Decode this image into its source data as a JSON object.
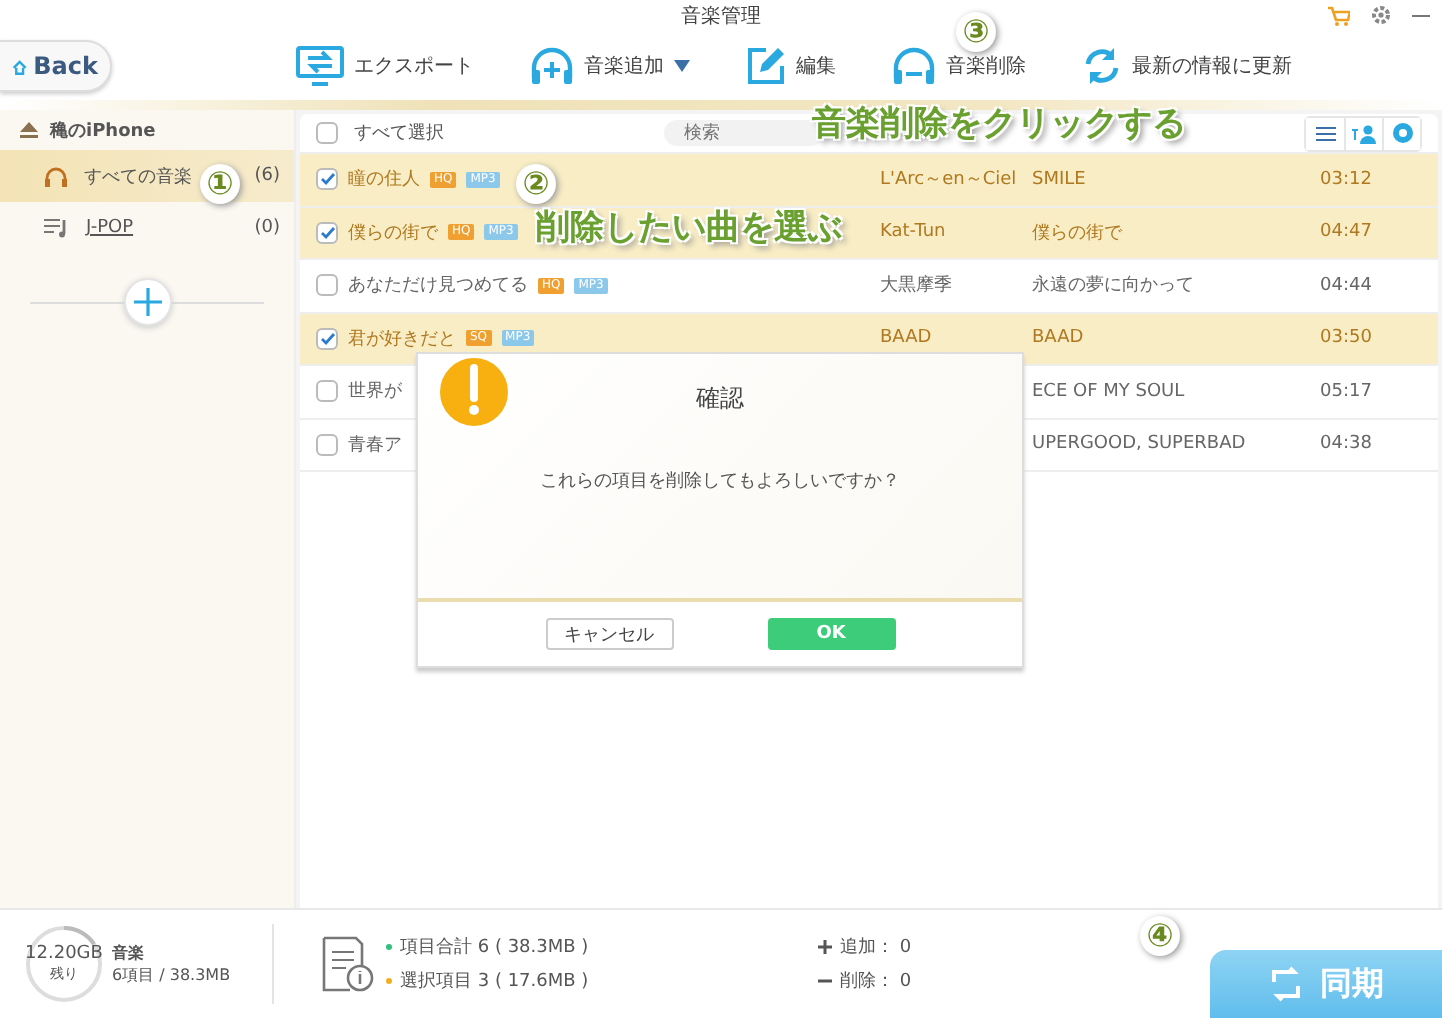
{
  "window": {
    "title": "音楽管理"
  },
  "back_button": "Back",
  "toolbar": [
    {
      "label": "エクスポート",
      "kind": "export",
      "dropdown": false
    },
    {
      "label": "音楽追加",
      "kind": "add",
      "dropdown": true
    },
    {
      "label": "編集",
      "kind": "edit",
      "dropdown": false
    },
    {
      "label": "音楽削除",
      "kind": "delete",
      "dropdown": false
    },
    {
      "label": "最新の情報に更新",
      "kind": "refresh",
      "dropdown": false
    }
  ],
  "sidebar": {
    "device": "穐のiPhone",
    "items": [
      {
        "label": "すべての音楽",
        "count": "(6)",
        "selected": true,
        "kind": "all"
      },
      {
        "label": "J-POP",
        "count": "(0)",
        "selected": false,
        "kind": "playlist"
      }
    ]
  },
  "list": {
    "select_all": {
      "label": "すべて選択",
      "checked": false
    },
    "search": {
      "placeholder": "検索"
    },
    "rows": [
      {
        "title": "瞳の住人",
        "badges": [
          "HQ",
          "MP3"
        ],
        "artist": "L'Arc～en～Ciel",
        "album": "SMILE",
        "time": "03:12",
        "checked": true
      },
      {
        "title": "僕らの街で",
        "badges": [
          "HQ",
          "MP3"
        ],
        "artist": "Kat-Tun",
        "album": "僕らの街で",
        "time": "04:47",
        "checked": true
      },
      {
        "title": "あなただけ見つめてる",
        "badges": [
          "HQ",
          "MP3"
        ],
        "artist": "大黒摩季",
        "album": "永遠の夢に向かって",
        "time": "04:44",
        "checked": false
      },
      {
        "title": "君が好きだと",
        "badges": [
          "SQ",
          "MP3"
        ],
        "artist": "BAAD",
        "album": "BAAD",
        "time": "03:50",
        "checked": true
      },
      {
        "title": "世界が",
        "badges": [],
        "artist": "",
        "album": "ECE OF MY SOUL",
        "time": "05:17",
        "checked": false
      },
      {
        "title": "青春ア",
        "badges": [],
        "artist": "",
        "album": "UPERGOOD, SUPERBAD",
        "time": "04:38",
        "checked": false
      }
    ]
  },
  "dialog": {
    "title": "確認",
    "message": "これらの項目を削除してもよろしいですか？",
    "buttons": [
      {
        "label": "キャンセル",
        "kind": "secondary"
      },
      {
        "label": "OK",
        "kind": "primary"
      }
    ]
  },
  "status": {
    "free": "12.20GB",
    "free_label": "残り",
    "category": "音楽",
    "summary": "6項目 / 38.3MB",
    "total": "項目合計 6 ( 38.3MB )",
    "selected": "選択項目 3 ( 17.6MB )",
    "added": "追加： 0",
    "deleted": "削除： 0",
    "sync_button": "同期"
  },
  "annotations": [
    {
      "label": "①"
    },
    {
      "label": "②"
    },
    {
      "label": "③"
    },
    {
      "label": "④"
    }
  ],
  "captions": [
    {
      "text": "音楽削除をクリックする"
    },
    {
      "text": "削除したい曲を選ぶ"
    }
  ]
}
